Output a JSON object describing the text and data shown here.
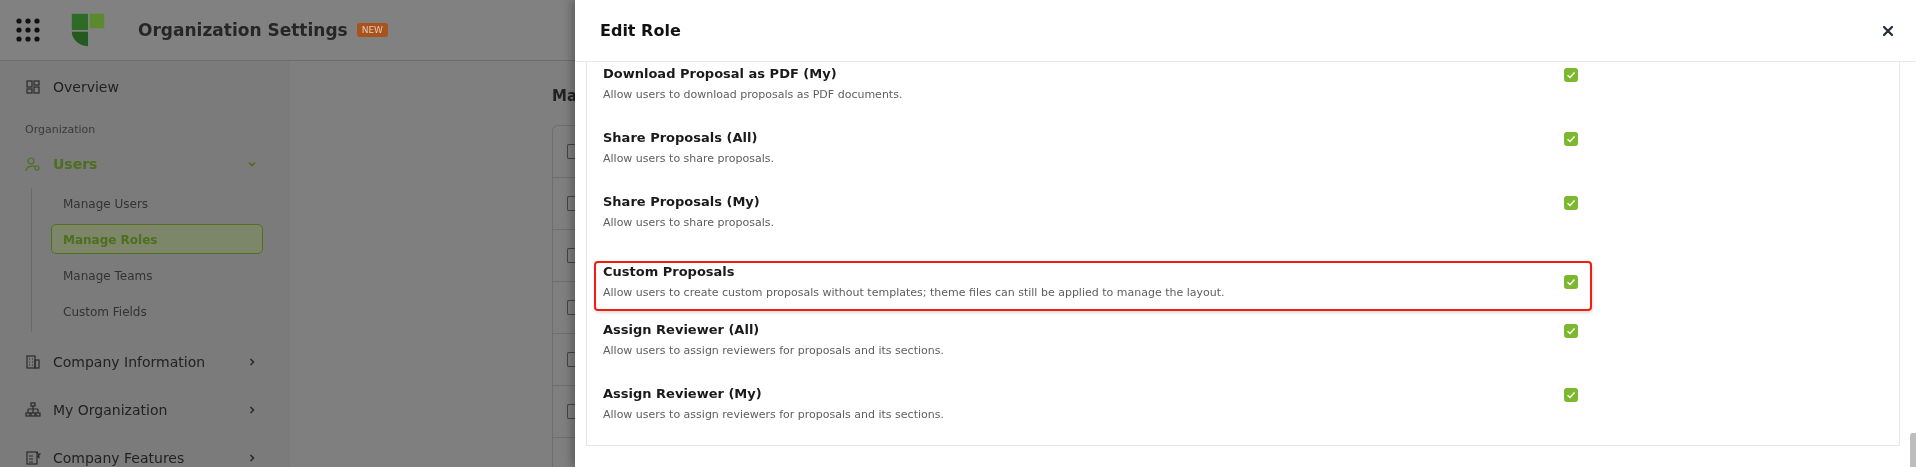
{
  "header": {
    "title": "Organization Settings",
    "badge": "NEW"
  },
  "sidebar": {
    "items": [
      {
        "kind": "link",
        "label": "Overview",
        "selected": false
      },
      {
        "kind": "heading",
        "label": "Organization"
      },
      {
        "kind": "group",
        "label": "Users",
        "selected": true,
        "expanded": true,
        "children": [
          {
            "label": "Manage Users",
            "selected": false
          },
          {
            "label": "Manage Roles",
            "selected": true
          },
          {
            "label": "Manage Teams",
            "selected": false
          },
          {
            "label": "Custom Fields",
            "selected": false
          }
        ]
      },
      {
        "kind": "group",
        "label": "Company Information",
        "selected": false,
        "expanded": false
      },
      {
        "kind": "group",
        "label": "My Organization",
        "selected": false,
        "expanded": false
      },
      {
        "kind": "group",
        "label": "Company Features",
        "selected": false,
        "expanded": false
      }
    ]
  },
  "main": {
    "title": "Ma",
    "rows": [
      {
        "checked": false
      },
      {
        "checked": false
      },
      {
        "checked": false
      },
      {
        "checked": false
      },
      {
        "checked": false
      },
      {
        "checked": false
      }
    ]
  },
  "modal": {
    "title": "Edit Role",
    "permissions": [
      {
        "title": "Download Proposal as PDF (My)",
        "description": "Allow users to download proposals as PDF documents.",
        "checked": true,
        "highlighted": false
      },
      {
        "title": "Share Proposals (All)",
        "description": "Allow users to share proposals.",
        "checked": true,
        "highlighted": false
      },
      {
        "title": "Share Proposals (My)",
        "description": "Allow users to share proposals.",
        "checked": true,
        "highlighted": false
      },
      {
        "title": "Custom Proposals",
        "description": "Allow users to create custom proposals without templates; theme files can still be applied to manage the layout.",
        "checked": true,
        "highlighted": true
      },
      {
        "title": "Assign Reviewer (All)",
        "description": "Allow users to assign reviewers for proposals and its sections.",
        "checked": true,
        "highlighted": false
      },
      {
        "title": "Assign Reviewer (My)",
        "description": "Allow users to assign reviewers for proposals and its sections.",
        "checked": true,
        "highlighted": false
      }
    ]
  }
}
